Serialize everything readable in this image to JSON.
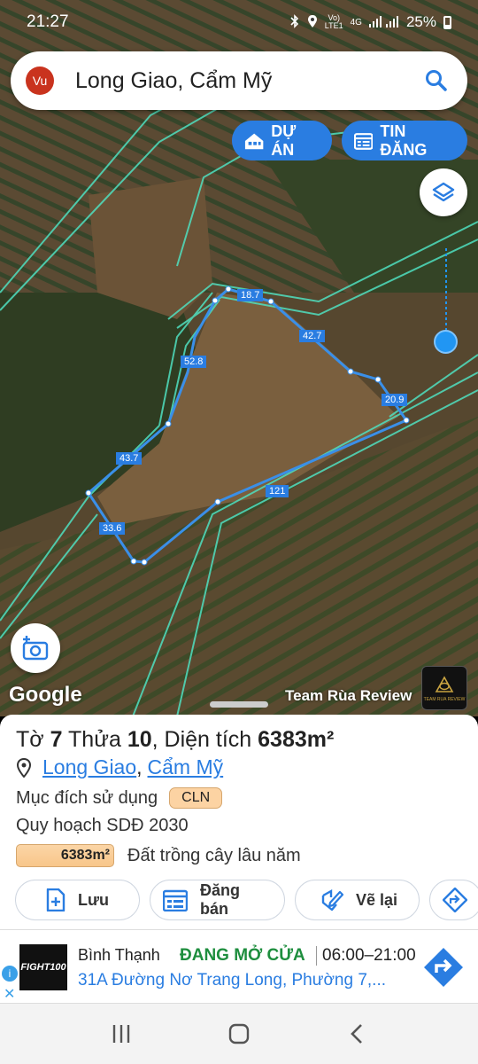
{
  "status_bar": {
    "time": "21:27",
    "network_top": "Vo)",
    "network_bottom": "LTE1",
    "network_type": "4G",
    "battery": "25%",
    "icons": [
      "bluetooth-icon",
      "location-icon",
      "signal-icon",
      "battery-icon"
    ]
  },
  "search": {
    "avatar_initials": "Vu",
    "avatar_color": "#c9331e",
    "query": "Long Giao, Cẩm Mỹ"
  },
  "map_buttons": {
    "projects_label": "DỰ ÁN",
    "listings_label": "TIN ĐĂNG",
    "accent_color": "#2a7de1"
  },
  "map": {
    "attribution": "Google",
    "watermark": "Team Rùa Review",
    "watermark_logo_text": "TEAM RUA REVIEW",
    "segment_lengths": [
      "18.7",
      "42.7",
      "20.9",
      "121",
      "33.6",
      "43.7",
      "52.8"
    ]
  },
  "parcel": {
    "to_label": "Tờ",
    "to_value": "7",
    "thua_label": "Thửa",
    "thua_value": "10",
    "area_label": ", Diện tích",
    "area_value": "6383m²",
    "commune": "Long Giao",
    "district": "Cẩm Mỹ",
    "separator": ",",
    "purpose_label": "Mục đích sử dụng",
    "purpose_code": "CLN",
    "plan_label": "Quy hoạch SDĐ 2030",
    "plan_area": "6383m²",
    "plan_type": "Đất trồng cây lâu năm"
  },
  "actions": {
    "save": "Lưu",
    "sell": "Đăng bán",
    "redraw": "Vẽ lại"
  },
  "ad": {
    "logo_text": "FIGHT100",
    "name": "Bình Thạnh",
    "status": "ĐANG MỞ CỬA",
    "hours": "06:00–21:00",
    "address": "31A Đường Nơ Trang Long, Phường 7,...",
    "info_symbol": "i",
    "close_symbol": "✕"
  }
}
